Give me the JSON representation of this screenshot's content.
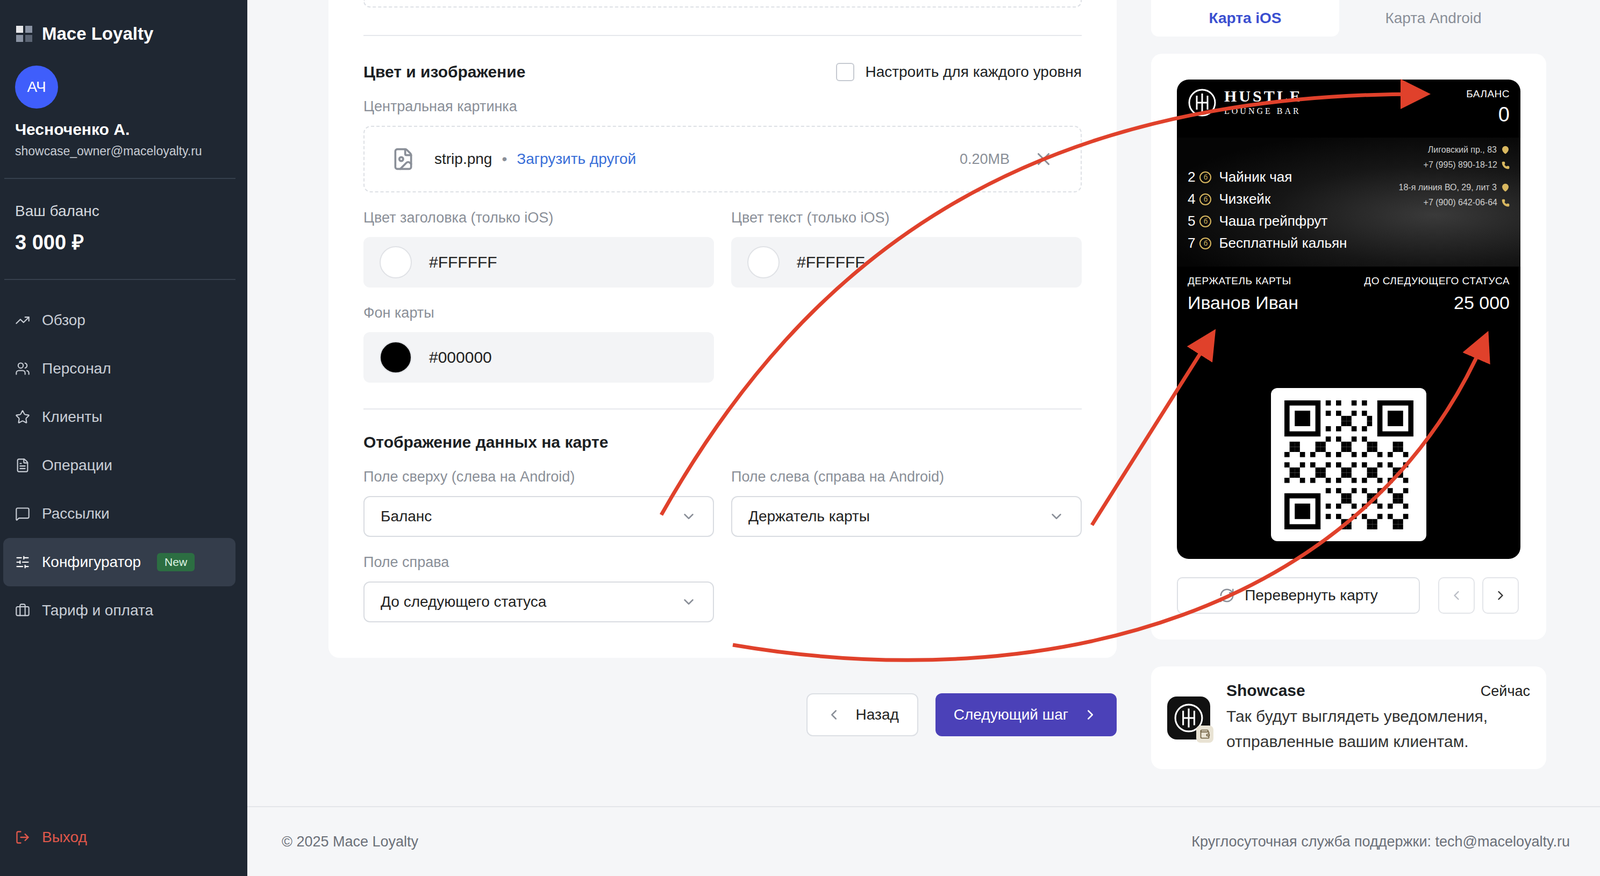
{
  "sidebar": {
    "logo": "Mace Loyalty",
    "user": {
      "initials": "АЧ",
      "name": "Чесноченко А.",
      "email": "showcase_owner@maceloyalty.ru"
    },
    "balance": {
      "label": "Ваш баланс",
      "value": "3 000 ₽"
    },
    "items": [
      {
        "label": "Обзор",
        "selected": false
      },
      {
        "label": "Персонал",
        "selected": false
      },
      {
        "label": "Клиенты",
        "selected": false
      },
      {
        "label": "Операции",
        "selected": false
      },
      {
        "label": "Рассылки",
        "selected": false
      },
      {
        "label": "Конфигуратор",
        "selected": true,
        "badge": "New"
      },
      {
        "label": "Тариф и оплата",
        "selected": false
      }
    ],
    "logout": "Выход"
  },
  "form": {
    "section_color": {
      "title": "Цвет и изображение",
      "checkbox": {
        "label": "Настроить для каждого уровня",
        "checked": false
      },
      "image": {
        "label": "Центральная картинка",
        "file": "strip.png",
        "separator": "•",
        "action": "Загрузить другой",
        "size": "0.20MB"
      },
      "colors": [
        {
          "label": "Цвет заголовка (только iOS)",
          "value": "#FFFFFF"
        },
        {
          "label": "Цвет текст (только iOS)",
          "value": "#FFFFFF"
        },
        {
          "label": "Фон карты",
          "value": "#000000"
        }
      ]
    },
    "section_fields": {
      "title": "Отображение данных на карте",
      "selects": [
        {
          "label": "Поле сверху (слева на Android)",
          "value": "Баланс"
        },
        {
          "label": "Поле слева (справа на Android)",
          "value": "Держатель карты"
        },
        {
          "label": "Поле справа",
          "value": "До следующего статуса"
        }
      ]
    },
    "buttons": {
      "back": "Назад",
      "next": "Следующий шаг"
    }
  },
  "preview": {
    "tabs": [
      {
        "label": "Карта iOS",
        "selected": true
      },
      {
        "label": "Карта Android",
        "selected": false
      }
    ],
    "card": {
      "brand": "HUSTLE",
      "brand_sub": "LOUNGE BAR",
      "balance_label": "БАЛАНС",
      "balance_value": "0",
      "coin": "б",
      "rewards": [
        {
          "points": "2",
          "name": "Чайник чая"
        },
        {
          "points": "4",
          "name": "Чизкейк"
        },
        {
          "points": "5",
          "name": "Чаша грейпфрут"
        },
        {
          "points": "7",
          "name": "Бесплатный кальян"
        }
      ],
      "locations": [
        {
          "address": "Лиговский пр., 83",
          "phone": "+7 (995) 890-18-12"
        },
        {
          "address": "18-я линия ВО, 29, лит 3",
          "phone": "+7 (900) 642-06-64"
        }
      ],
      "fields": [
        {
          "label": "ДЕРЖАТЕЛЬ КАРТЫ",
          "value": "Иванов Иван"
        },
        {
          "label": "ДО СЛЕДУЮЩЕГО СТАТУСА",
          "value": "25 000"
        }
      ]
    },
    "flip": "Перевернуть карту",
    "pager": {
      "prev_disabled": true,
      "next_disabled": false
    },
    "notification": {
      "title": "Showcase",
      "time": "Сейчас",
      "body": "Так будут выглядеть уведомления, отправленные вашим клиентам."
    }
  },
  "footer": {
    "copyright": "© 2025 Mace Loyalty",
    "support": "Круглосуточная служба поддержки: tech@maceloyalty.ru"
  }
}
